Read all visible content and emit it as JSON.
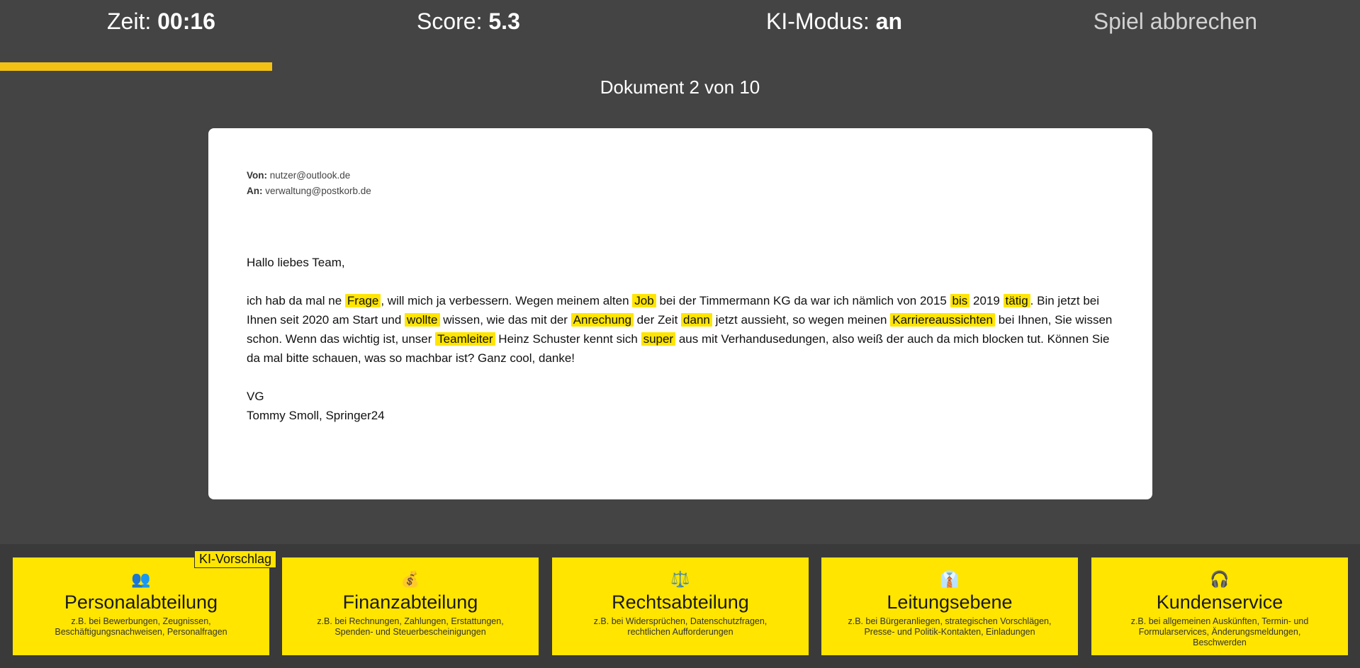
{
  "header": {
    "time_label": "Zeit: ",
    "time_value": "00:16",
    "score_label": "Score: ",
    "score_value": "5.3",
    "ai_label": "KI-Modus: ",
    "ai_value": "an",
    "quit_label": "Spiel abbrechen",
    "progress_fraction": 0.2
  },
  "document": {
    "counter": "Dokument 2 von 10",
    "from_label": "Von:",
    "from_value": " nutzer@outlook.de",
    "to_label": "An:",
    "to_value": " verwaltung@postkorb.de",
    "greeting": "Hallo liebes Team,",
    "body": [
      {
        "t": "ich hab da mal ne "
      },
      {
        "t": "Frage",
        "h": true
      },
      {
        "t": ", will mich ja verbessern. Wegen meinem alten "
      },
      {
        "t": "Job",
        "h": true
      },
      {
        "t": " bei der Timmermann KG da war ich nämlich von 2015 "
      },
      {
        "t": "bis",
        "h": true
      },
      {
        "t": " 2019 "
      },
      {
        "t": "tätig",
        "h": true
      },
      {
        "t": ". Bin jetzt bei Ihnen seit 2020 am Start und "
      },
      {
        "t": "wollte",
        "h": true
      },
      {
        "t": " wissen, wie das mit der "
      },
      {
        "t": "Anrechung",
        "h": true
      },
      {
        "t": " der Zeit "
      },
      {
        "t": "dann",
        "h": true
      },
      {
        "t": " jetzt aussieht, so wegen meinen "
      },
      {
        "t": "Karriereaussichten",
        "h": true
      },
      {
        "t": " bei Ihnen, Sie wissen schon. Wenn das wichtig ist, unser "
      },
      {
        "t": "Teamleiter",
        "h": true
      },
      {
        "t": " Heinz Schuster kennt sich "
      },
      {
        "t": "super",
        "h": true
      },
      {
        "t": " aus mit Verhandusedungen, also weiß der auch da mich blocken tut. Können Sie da mal bitte schauen, was so machbar ist? Ganz cool, danke!"
      }
    ],
    "closing": "VG",
    "signature": "Tommy Smoll, Springer24"
  },
  "departments": [
    {
      "icon": "👥",
      "icon_name": "people-icon",
      "name": "Personalabteilung",
      "desc": "z.B. bei Bewerbungen, Zeugnissen, Beschäftigungsnachweisen, Personalfragen",
      "badge": "KI-Vorschlag"
    },
    {
      "icon": "💰",
      "icon_name": "money-bag-icon",
      "name": "Finanzabteilung",
      "desc": "z.B. bei Rechnungen, Zahlungen, Erstattungen, Spenden- und Steuerbescheinigungen"
    },
    {
      "icon": "⚖️",
      "icon_name": "scales-icon",
      "name": "Rechtsabteilung",
      "desc": "z.B. bei Widersprüchen, Datenschutzfragen, rechtlichen Aufforderungen"
    },
    {
      "icon": "👔",
      "icon_name": "necktie-icon",
      "name": "Leitungsebene",
      "desc": "z.B. bei Bürgeranliegen, strategischen Vorschlägen, Presse- und Politik-Kontakten, Einladungen"
    },
    {
      "icon": "🎧",
      "icon_name": "headphones-icon",
      "name": "Kundenservice",
      "desc": "z.B. bei allgemeinen Auskünften, Termin- und Formularservices, Änderungsmeldungen, Beschwerden"
    }
  ],
  "colors": {
    "background": "#444444",
    "accent": "#ffe500",
    "progress": "#f3c114",
    "card": "#ffffff"
  }
}
